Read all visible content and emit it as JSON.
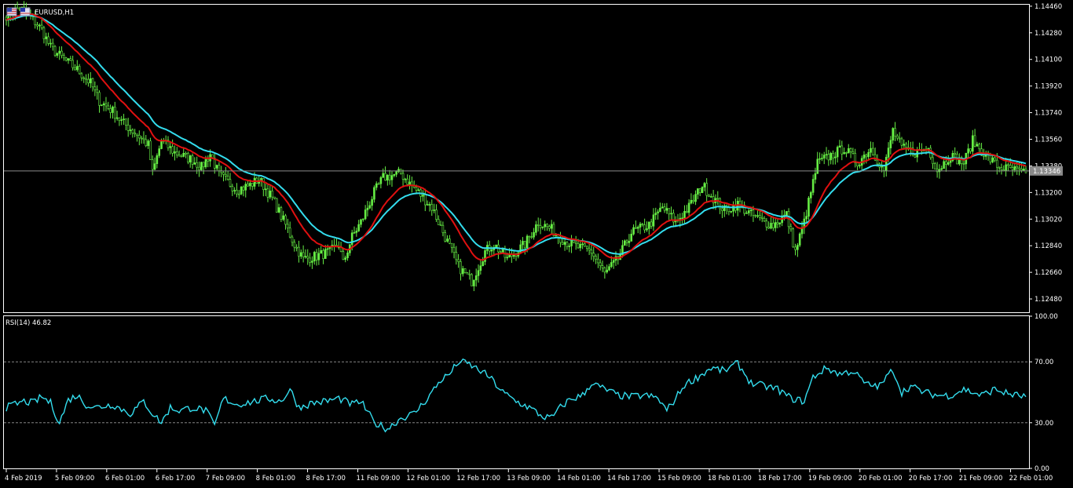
{
  "chart_data": [
    {
      "type": "candlestick",
      "title": "EURUSD,H1",
      "symbol": "EURUSD",
      "timeframe": "H1",
      "current_price": "1.13346",
      "colors": {
        "background": "#000000",
        "candles": "#66ee44",
        "ma_fast": "#e01010",
        "ma_slow": "#33ddee",
        "price_line": "#8a8a8a",
        "axis": "#ffffff"
      },
      "ylim": [
        1.1239,
        1.1447
      ],
      "y_ticks": [
        "1.14460",
        "1.14280",
        "1.14100",
        "1.13920",
        "1.13740",
        "1.13560",
        "1.13380",
        "1.13200",
        "1.13020",
        "1.12840",
        "1.12660",
        "1.12480"
      ],
      "x_tick_labels": [
        "4 Feb 2019",
        "5 Feb 09:00",
        "6 Feb 01:00",
        "6 Feb 17:00",
        "7 Feb 09:00",
        "8 Feb 01:00",
        "8 Feb 17:00",
        "11 Feb 09:00",
        "12 Feb 01:00",
        "12 Feb 17:00",
        "13 Feb 09:00",
        "14 Feb 01:00",
        "14 Feb 17:00",
        "15 Feb 09:00",
        "18 Feb 01:00",
        "18 Feb 17:00",
        "19 Feb 09:00",
        "20 Feb 01:00",
        "20 Feb 17:00",
        "21 Feb 09:00",
        "22 Feb 01:00"
      ],
      "close_anchors": [
        [
          0,
          1.144
        ],
        [
          6,
          1.1445
        ],
        [
          12,
          1.1437
        ],
        [
          16,
          1.143
        ],
        [
          20,
          1.1418
        ],
        [
          26,
          1.141
        ],
        [
          32,
          1.1403
        ],
        [
          38,
          1.1394
        ],
        [
          42,
          1.1382
        ],
        [
          48,
          1.1375
        ],
        [
          52,
          1.1368
        ],
        [
          56,
          1.1363
        ],
        [
          60,
          1.1358
        ],
        [
          64,
          1.1352
        ],
        [
          66,
          1.1333
        ],
        [
          70,
          1.1355
        ],
        [
          76,
          1.1347
        ],
        [
          84,
          1.1342
        ],
        [
          88,
          1.1337
        ],
        [
          92,
          1.1346
        ],
        [
          96,
          1.1332
        ],
        [
          104,
          1.1322
        ],
        [
          110,
          1.1325
        ],
        [
          114,
          1.1329
        ],
        [
          120,
          1.1316
        ],
        [
          126,
          1.1298
        ],
        [
          130,
          1.1285
        ],
        [
          134,
          1.1275
        ],
        [
          140,
          1.1277
        ],
        [
          146,
          1.128
        ],
        [
          150,
          1.1285
        ],
        [
          152,
          1.1272
        ],
        [
          156,
          1.129
        ],
        [
          160,
          1.13
        ],
        [
          166,
          1.132
        ],
        [
          170,
          1.133
        ],
        [
          178,
          1.1333
        ],
        [
          182,
          1.1326
        ],
        [
          186,
          1.132
        ],
        [
          192,
          1.131
        ],
        [
          198,
          1.129
        ],
        [
          204,
          1.127
        ],
        [
          210,
          1.126
        ],
        [
          216,
          1.128
        ],
        [
          220,
          1.1285
        ],
        [
          226,
          1.1275
        ],
        [
          234,
          1.1285
        ],
        [
          240,
          1.13
        ],
        [
          246,
          1.1295
        ],
        [
          252,
          1.1287
        ],
        [
          258,
          1.1283
        ],
        [
          264,
          1.128
        ],
        [
          270,
          1.1265
        ],
        [
          276,
          1.1275
        ],
        [
          282,
          1.1293
        ],
        [
          290,
          1.1298
        ],
        [
          296,
          1.131
        ],
        [
          302,
          1.13
        ],
        [
          308,
          1.131
        ],
        [
          314,
          1.1325
        ],
        [
          318,
          1.1318
        ],
        [
          324,
          1.1308
        ],
        [
          330,
          1.1312
        ],
        [
          336,
          1.1305
        ],
        [
          342,
          1.13
        ],
        [
          346,
          1.1298
        ],
        [
          352,
          1.1305
        ],
        [
          356,
          1.128
        ],
        [
          360,
          1.13
        ],
        [
          366,
          1.134
        ],
        [
          372,
          1.1345
        ],
        [
          378,
          1.135
        ],
        [
          384,
          1.134
        ],
        [
          390,
          1.135
        ],
        [
          396,
          1.1335
        ],
        [
          400,
          1.1362
        ],
        [
          404,
          1.135
        ],
        [
          410,
          1.1347
        ],
        [
          416,
          1.135
        ],
        [
          420,
          1.1335
        ],
        [
          426,
          1.1345
        ],
        [
          432,
          1.134
        ],
        [
          436,
          1.1355
        ],
        [
          442,
          1.1345
        ],
        [
          448,
          1.1337
        ],
        [
          455,
          1.1335
        ],
        [
          460,
          1.1332
        ]
      ]
    },
    {
      "type": "line",
      "title": "RSI(14) 46.82",
      "indicator": "RSI(14)",
      "value": "46.82",
      "colors": {
        "line": "#33ddee",
        "levels": "#9a9a9a"
      },
      "ylim": [
        0,
        100
      ],
      "y_ticks": [
        "100.00",
        "70.00",
        "30.00",
        "0.00"
      ],
      "levels": [
        70,
        30
      ],
      "anchors": [
        [
          0,
          40
        ],
        [
          8,
          44
        ],
        [
          12,
          43
        ],
        [
          16,
          47
        ],
        [
          20,
          43
        ],
        [
          24,
          30
        ],
        [
          28,
          45
        ],
        [
          32,
          48
        ],
        [
          36,
          42
        ],
        [
          40,
          40
        ],
        [
          48,
          42
        ],
        [
          56,
          36
        ],
        [
          62,
          44
        ],
        [
          66,
          36
        ],
        [
          70,
          30
        ],
        [
          74,
          40
        ],
        [
          78,
          38
        ],
        [
          84,
          40
        ],
        [
          90,
          38
        ],
        [
          94,
          28
        ],
        [
          98,
          46
        ],
        [
          104,
          42
        ],
        [
          112,
          44
        ],
        [
          118,
          46
        ],
        [
          124,
          44
        ],
        [
          128,
          52
        ],
        [
          132,
          40
        ],
        [
          138,
          43
        ],
        [
          144,
          44
        ],
        [
          150,
          46
        ],
        [
          156,
          42
        ],
        [
          160,
          44
        ],
        [
          166,
          30
        ],
        [
          172,
          26
        ],
        [
          178,
          33
        ],
        [
          184,
          36
        ],
        [
          190,
          46
        ],
        [
          196,
          58
        ],
        [
          200,
          62
        ],
        [
          204,
          70
        ],
        [
          208,
          69
        ],
        [
          214,
          64
        ],
        [
          218,
          60
        ],
        [
          224,
          50
        ],
        [
          230,
          44
        ],
        [
          236,
          40
        ],
        [
          242,
          34
        ],
        [
          246,
          33
        ],
        [
          250,
          40
        ],
        [
          254,
          45
        ],
        [
          260,
          48
        ],
        [
          264,
          56
        ],
        [
          270,
          52
        ],
        [
          276,
          48
        ],
        [
          282,
          47
        ],
        [
          288,
          48
        ],
        [
          294,
          46
        ],
        [
          298,
          38
        ],
        [
          302,
          46
        ],
        [
          306,
          55
        ],
        [
          312,
          60
        ],
        [
          318,
          66
        ],
        [
          324,
          64
        ],
        [
          330,
          69
        ],
        [
          336,
          56
        ],
        [
          342,
          54
        ],
        [
          348,
          52
        ],
        [
          354,
          46
        ],
        [
          360,
          44
        ],
        [
          364,
          60
        ],
        [
          370,
          66
        ],
        [
          376,
          62
        ],
        [
          382,
          64
        ],
        [
          388,
          55
        ],
        [
          394,
          54
        ],
        [
          400,
          65
        ],
        [
          404,
          50
        ],
        [
          408,
          54
        ],
        [
          414,
          50
        ],
        [
          420,
          48
        ],
        [
          426,
          48
        ],
        [
          432,
          52
        ],
        [
          436,
          50
        ],
        [
          440,
          48
        ],
        [
          446,
          52
        ],
        [
          452,
          49
        ],
        [
          460,
          47
        ]
      ]
    }
  ]
}
